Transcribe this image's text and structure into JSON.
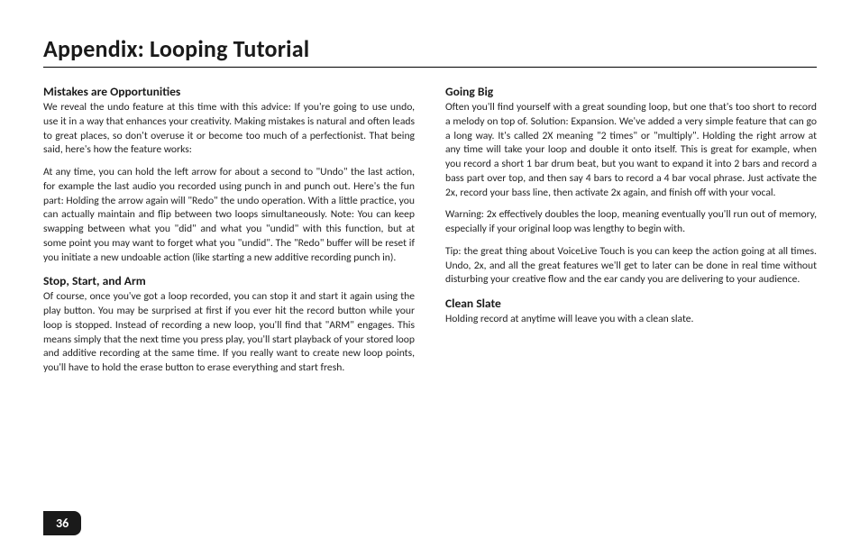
{
  "page": {
    "title": "Appendix: Looping Tutorial",
    "number": "36"
  },
  "left": {
    "s1": {
      "heading": "Mistakes are Opportunities",
      "p1": "We reveal the undo feature at this time with this advice:  If you're going to use undo, use it in a way that enhances your creativity.  Making mistakes is natural and often leads to great places, so don't overuse it or become too much of a perfectionist.  That being said, here's how the feature works:",
      "p2": "At any time, you can hold the left arrow for about a second to \"Undo\" the last action, for example the last audio you recorded using punch in and punch out.  Here's the fun part:  Holding the arrow again will \"Redo\" the undo operation.  With a little practice, you can actually maintain and flip between two loops simultaneously.  Note:  You can keep swapping between what you \"did\" and what you \"undid\" with this function, but at some point you may want to forget what you \"undid\".  The \"Redo\" buffer will be reset if you initiate a new undoable action (like starting a new additive recording punch in)."
    },
    "s2": {
      "heading": "Stop, Start, and Arm",
      "p1": "Of course, once you've got a loop recorded, you can stop it and start it again using the play button.  You may be surprised at first if you ever hit the record button while your loop is stopped.  Instead of recording a new loop, you'll find that \"ARM\" engages.  This means simply that the next time you press play, you'll start playback of your stored loop and additive recording at the same time.  If you really want to create new loop points, you'll have to hold the erase button to erase everything and start fresh."
    }
  },
  "right": {
    "s1": {
      "heading": "Going Big",
      "p1": "Often you'll find yourself with a great sounding loop, but one that's too short to record a melody on top of.  Solution: Expansion.  We've added a very simple feature that can go a long way.  It's called 2X meaning \"2 times\" or \"multiply\".  Holding the right arrow at any time will take your loop and double it onto itself.  This is great for example, when you record a short 1 bar drum beat, but you want to expand it into 2 bars and record a bass part over top, and then say 4 bars to record a 4 bar vocal phrase.  Just activate the 2x, record your bass line, then activate 2x again, and finish off with your vocal.",
      "p2": "Warning:  2x effectively doubles the loop, meaning eventually you'll run out of memory, especially if your original loop was lengthy to begin with.",
      "p3": "Tip: the great thing about VoiceLive Touch is you can keep the action going at all times.  Undo, 2x, and all the great features we'll get to later can be done in real time without disturbing your creative flow and the ear candy you are delivering to your audience."
    },
    "s2": {
      "heading": "Clean Slate",
      "p1": "Holding record at anytime will leave you with a clean slate."
    }
  }
}
